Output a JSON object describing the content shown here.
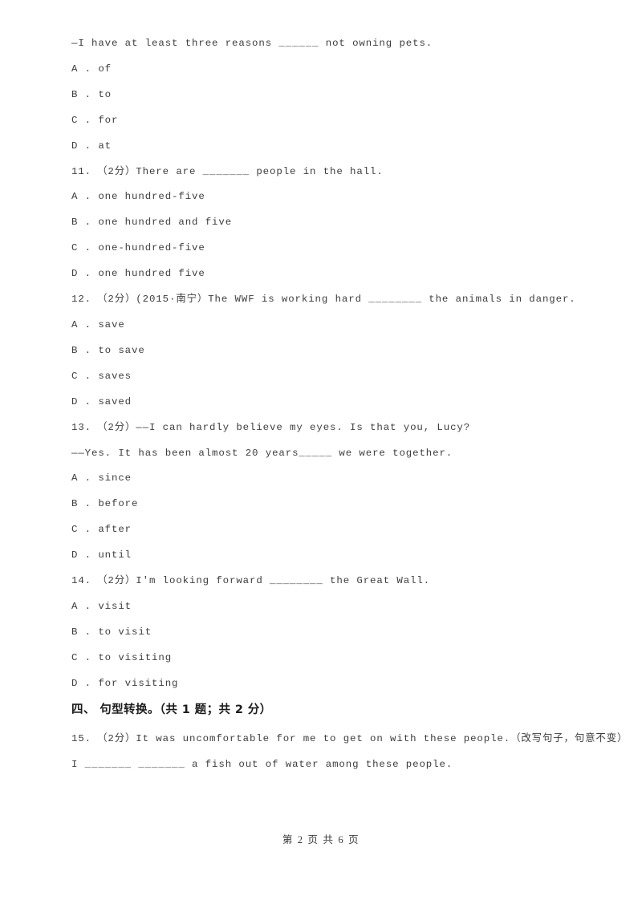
{
  "document": {
    "page_footer": "第 2 页 共 6 页"
  },
  "questions": [
    {
      "id": "q10-continued",
      "stem": "—I have at least three reasons ______ not owning pets.",
      "options": [
        "A . of",
        "B . to",
        "C . for",
        "D . at"
      ]
    },
    {
      "id": "q11",
      "stem": "11.　（2分）There are _______ people in the hall.",
      "options": [
        "A . one hundred-five",
        "B . one hundred and five",
        "C . one-hundred-five",
        "D . one hundred five"
      ]
    },
    {
      "id": "q12",
      "stem": "12.　（2分）(2015·南宁）The WWF is working hard ________ the animals in danger.",
      "options": [
        "A . save",
        "B . to save",
        "C . saves",
        "D . saved"
      ]
    },
    {
      "id": "q13",
      "stem": "13.　（2分）——I can hardly believe my eyes. Is that you, Lucy?",
      "stem_line2": "——Yes. It has been almost 20 years_____ we were together.",
      "options": [
        "A . since",
        "B . before",
        "C . after",
        "D . until"
      ]
    },
    {
      "id": "q14",
      "stem": "14.　（2分）I'm looking forward ________ the Great Wall.",
      "options": [
        "A . visit",
        "B . to visit",
        "C . to visiting",
        "D . for visiting"
      ]
    }
  ],
  "section": {
    "heading": "四、 句型转换。（共 1 题；共 2 分）"
  },
  "transform_question": {
    "id": "q15",
    "stem": "15.　（2分）It was uncomfortable for me to get on with these people.（改写句子，句意不变）",
    "answer_line": "I _______ _______ a fish out of water among these people."
  }
}
